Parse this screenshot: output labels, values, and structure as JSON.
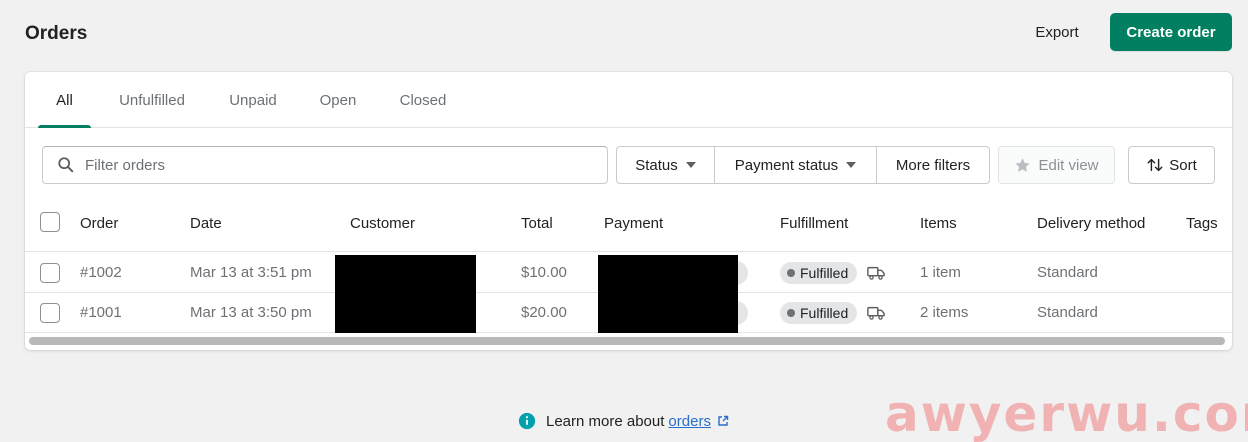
{
  "header": {
    "title": "Orders",
    "export_label": "Export",
    "create_label": "Create order"
  },
  "tabs": [
    {
      "label": "All",
      "active": true
    },
    {
      "label": "Unfulfilled",
      "active": false
    },
    {
      "label": "Unpaid",
      "active": false
    },
    {
      "label": "Open",
      "active": false
    },
    {
      "label": "Closed",
      "active": false
    }
  ],
  "filters": {
    "search_placeholder": "Filter orders",
    "search_value": "",
    "status_label": "Status",
    "payment_status_label": "Payment status",
    "more_filters_label": "More filters",
    "edit_view_label": "Edit view",
    "sort_label": "Sort"
  },
  "table": {
    "columns": [
      "Order",
      "Date",
      "Customer",
      "Total",
      "Payment",
      "Fulfillment",
      "Items",
      "Delivery method",
      "Tags"
    ],
    "rows": [
      {
        "order": "#1002",
        "date": "Mar 13 at 3:51 pm",
        "total": "$10.00",
        "fulfillment": "Fulfilled",
        "items": "1 item",
        "delivery": "Standard"
      },
      {
        "order": "#1001",
        "date": "Mar 13 at 3:50 pm",
        "total": "$20.00",
        "fulfillment": "Fulfilled",
        "items": "2 items",
        "delivery": "Standard"
      }
    ]
  },
  "footer": {
    "prefix": "Learn more about",
    "link": "orders"
  },
  "watermark": "awyerwu.com",
  "colors": {
    "primary": "#008060",
    "link": "#2c6ecb",
    "background": "#f1f1f1"
  }
}
